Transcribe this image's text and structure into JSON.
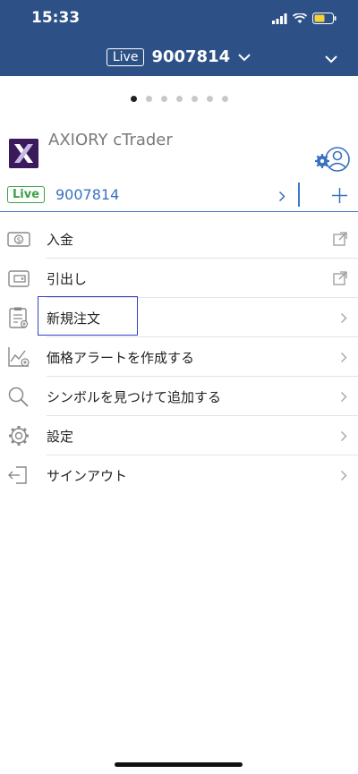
{
  "status_bar": {
    "time": "15:33"
  },
  "header": {
    "live_tag": "Live",
    "account_number": "9007814"
  },
  "pager": {
    "count": 7,
    "active_index": 0
  },
  "brand": {
    "name": "AXIORY cTrader"
  },
  "account_row": {
    "badge": "Live",
    "account_number": "9007814"
  },
  "menu": {
    "items": [
      {
        "label": "入金"
      },
      {
        "label": "引出し"
      },
      {
        "label": "新規注文"
      },
      {
        "label": "価格アラートを作成する"
      },
      {
        "label": "シンボルを見つけて追加する"
      },
      {
        "label": "設定"
      },
      {
        "label": "サインアウト"
      }
    ]
  },
  "colors": {
    "header_bg": "#2d5186",
    "accent_blue": "#3a70c0",
    "live_green": "#3ea04a",
    "highlight": "#3340c8"
  }
}
